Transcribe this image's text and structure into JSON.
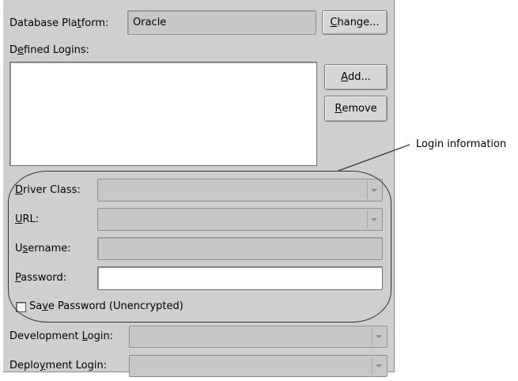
{
  "platform": {
    "label_prefix": "Database Pla",
    "label_mnemonic": "t",
    "label_suffix": "form:",
    "value": "Oracle",
    "change_prefix": "",
    "change_mnemonic": "C",
    "change_suffix": "hange..."
  },
  "logins": {
    "label_prefix": "D",
    "label_mnemonic": "e",
    "label_suffix": "fined Logins:",
    "add_prefix": "",
    "add_mnemonic": "A",
    "add_suffix": "dd...",
    "remove_prefix": "",
    "remove_mnemonic": "R",
    "remove_suffix": "emove"
  },
  "login_info": {
    "driver_mnemonic": "D",
    "driver_suffix": "river Class:",
    "url_mnemonic": "U",
    "url_suffix": "RL:",
    "username_prefix": "U",
    "username_mnemonic": "s",
    "username_suffix": "ername:",
    "password_mnemonic": "P",
    "password_suffix": "assword:",
    "save_prefix": "Sa",
    "save_mnemonic": "v",
    "save_suffix": "e Password (Unencrypted)",
    "save_checked": false
  },
  "development": {
    "label_prefix": "Development ",
    "label_mnemonic": "L",
    "label_suffix": "ogin:"
  },
  "deployment": {
    "label_prefix": "Deplo",
    "label_mnemonic": "y",
    "label_suffix": "ment Login:"
  },
  "callout": {
    "text": "Login information"
  }
}
